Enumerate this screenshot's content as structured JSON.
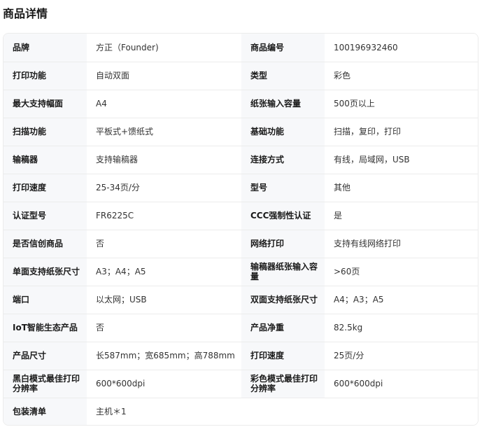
{
  "page_title": "商品详情",
  "rows": [
    {
      "k1": "品牌",
      "v1": "方正（Founder)",
      "k2": "商品编号",
      "v2": "100196932460"
    },
    {
      "k1": "打印功能",
      "v1": "自动双面",
      "k2": "类型",
      "v2": "彩色"
    },
    {
      "k1": "最大支持幅面",
      "v1": "A4",
      "k2": "纸张输入容量",
      "v2": "500页以上"
    },
    {
      "k1": "扫描功能",
      "v1": "平板式+馈纸式",
      "k2": "基础功能",
      "v2": "扫描，复印，打印"
    },
    {
      "k1": "输稿器",
      "v1": "支持输稿器",
      "k2": "连接方式",
      "v2": "有线，局域网，USB"
    },
    {
      "k1": "打印速度",
      "v1": "25-34页/分",
      "k2": "型号",
      "v2": "其他"
    },
    {
      "k1": "认证型号",
      "v1": "FR6225C",
      "k2": "CCC强制性认证",
      "v2": "是"
    },
    {
      "k1": "是否信创商品",
      "v1": "否",
      "k2": "网络打印",
      "v2": "支持有线网络打印"
    },
    {
      "k1": "单面支持纸张尺寸",
      "v1": "A3；A4；A5",
      "k2": "输稿器纸张输入容量",
      "v2": ">60页"
    },
    {
      "k1": "端口",
      "v1": "以太网；USB",
      "k2": "双面支持纸张尺寸",
      "v2": "A4；A3；A5"
    },
    {
      "k1": "IoT智能生态产品",
      "v1": "否",
      "k2": "产品净重",
      "v2": "82.5kg"
    },
    {
      "k1": "产品尺寸",
      "v1": "长587mm；宽685mm；高788mm",
      "k2": "打印速度",
      "v2": "25页/分"
    },
    {
      "k1": "黑白模式最佳打印分辨率",
      "v1": "600*600dpi",
      "k2": "彩色模式最佳打印分辨率",
      "v2": "600*600dpi"
    }
  ],
  "last_row": {
    "k1": "包装清单",
    "v1": "主机＊1"
  }
}
